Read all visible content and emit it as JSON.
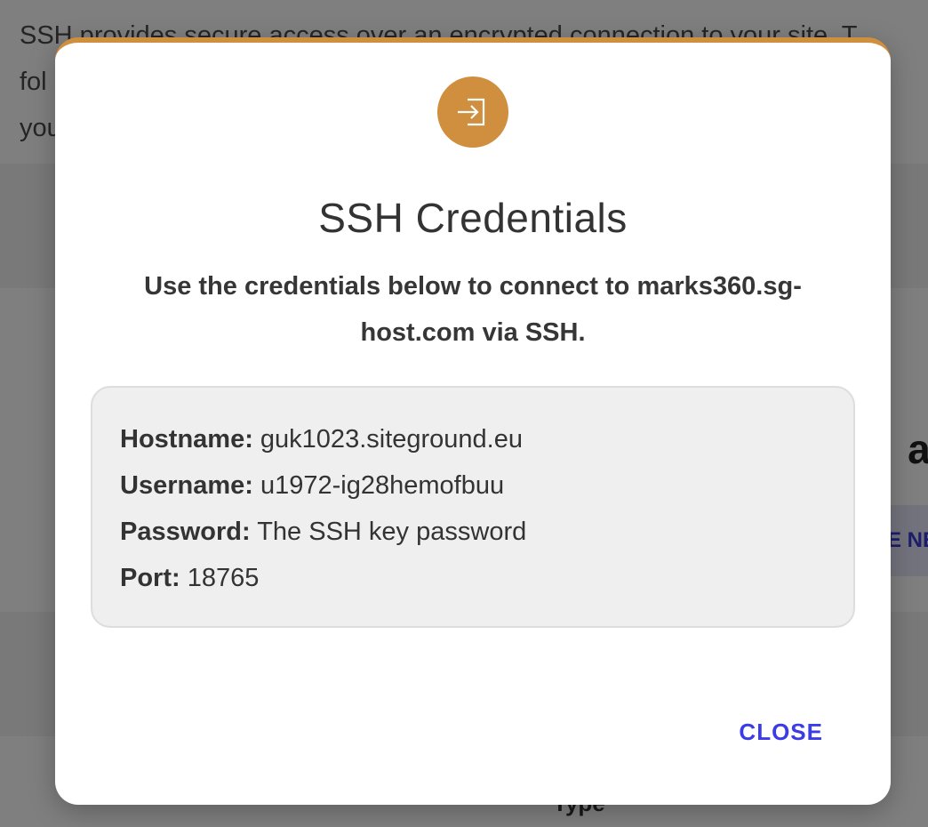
{
  "background": {
    "intro_lines": [
      "SSH provides secure access over an encrypted connection to your site. T",
      "fol                                                                          nd",
      "you"
    ],
    "heading_fragment": "at",
    "create_button_fragment": "E NE",
    "table_column": "Type"
  },
  "modal": {
    "icon": "login-arrow-icon",
    "title": "SSH Credentials",
    "subtitle": "Use the credentials below to connect to marks360.sg-host.com via SSH.",
    "credentials": [
      {
        "label": "Hostname:",
        "value": "guk1023.siteground.eu"
      },
      {
        "label": "Username:",
        "value": "u1972-ig28hemofbuu"
      },
      {
        "label": "Password:",
        "value": "The SSH key password"
      },
      {
        "label": "Port:",
        "value": "18765"
      }
    ],
    "close_label": "CLOSE"
  },
  "colors": {
    "accent": "#d08f3e",
    "link": "#3b3be8",
    "overlay": "rgba(0,0,0,0.5)"
  }
}
